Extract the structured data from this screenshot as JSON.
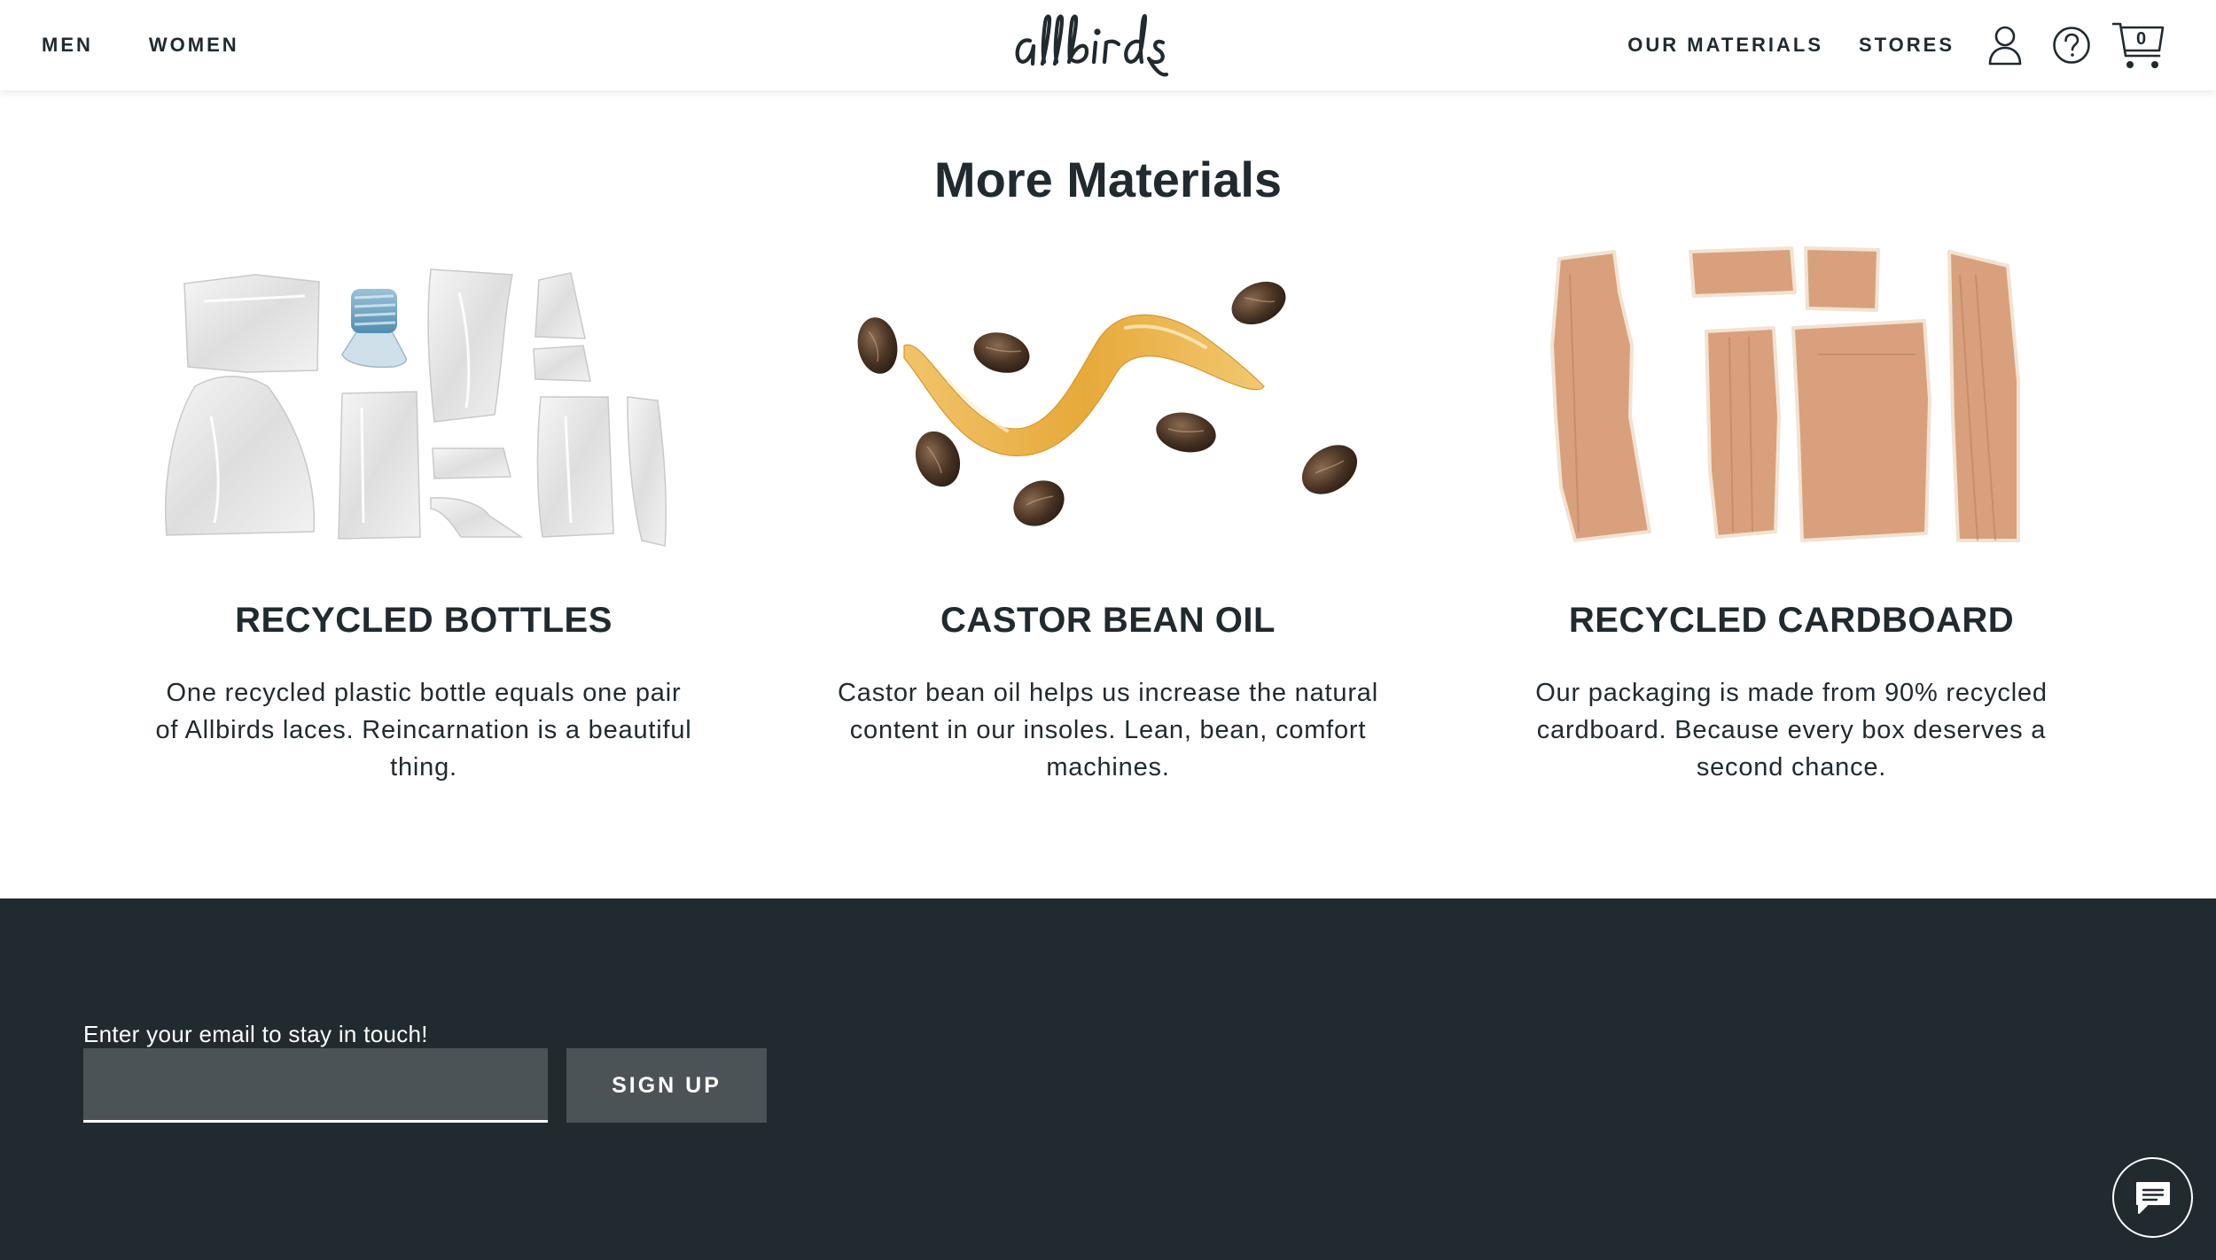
{
  "header": {
    "nav_left": [
      "MEN",
      "WOMEN"
    ],
    "logo_text": "allbirds",
    "nav_right": [
      "OUR MATERIALS",
      "STORES"
    ],
    "icons": [
      "account-icon",
      "help-icon",
      "cart-icon"
    ],
    "cart_count": "0"
  },
  "main": {
    "title": "More Materials",
    "cards": [
      {
        "title": "RECYCLED BOTTLES",
        "text": "One recycled plastic bottle equals one pair of Allbirds laces. Reincarnation is a beautiful thing."
      },
      {
        "title": "CASTOR BEAN OIL",
        "text": "Castor bean oil helps us increase the natural content in our insoles. Lean, bean, comfort machines."
      },
      {
        "title": "RECYCLED CARDBOARD",
        "text": "Our packaging is made from 90% recycled cardboard. Because every box deserves a second chance."
      }
    ]
  },
  "footer": {
    "email_label": "Enter your email to stay in touch!",
    "email_value": "",
    "signup_label": "SIGN UP",
    "chat_icon": "chat-icon"
  },
  "colors": {
    "text": "#212a2f",
    "footer_bg": "#212a2f",
    "input_bg": "#4c5356"
  }
}
